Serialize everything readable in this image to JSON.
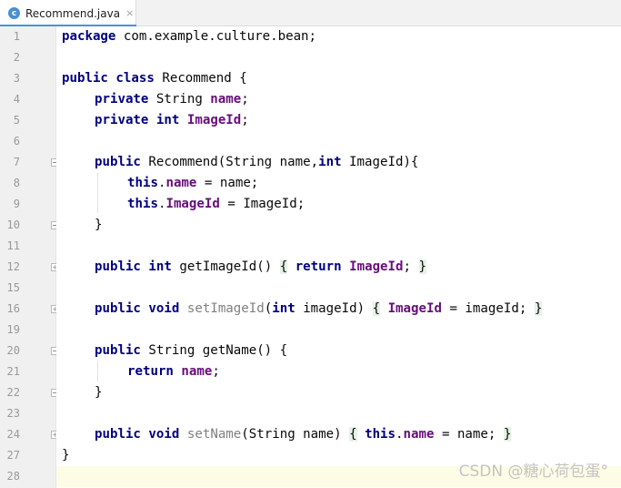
{
  "tab": {
    "title": "Recommend.java",
    "icon_letter": "c",
    "close_glyph": "×"
  },
  "line_numbers": [
    "1",
    "2",
    "3",
    "4",
    "5",
    "6",
    "7",
    "8",
    "9",
    "10",
    "11",
    "12",
    "15",
    "16",
    "19",
    "20",
    "21",
    "22",
    "23",
    "24",
    "27",
    "28"
  ],
  "code": {
    "l1_kw": "package",
    "l1_rest": " com.example.culture.bean;",
    "l3_kw1": "public",
    "l3_kw2": "class",
    "l3_rest": " Recommend {",
    "l4_kw": "private",
    "l4_type": " String ",
    "l4_field": "name",
    "l4_end": ";",
    "l5_kw1": "private",
    "l5_kw2": "int",
    "l5_field": "ImageId",
    "l5_end": ";",
    "l7_kw": "public",
    "l7_a": " Recommend(String name,",
    "l7_kw2": "int",
    "l7_b": " ImageId){",
    "l8_kw": "this",
    "l8_dot": ".",
    "l8_field": "name",
    "l8_rest": " = name;",
    "l9_kw": "this",
    "l9_dot": ".",
    "l9_field": "ImageId",
    "l9_rest": " = ImageId;",
    "l10": "}",
    "l12_kw1": "public",
    "l12_kw2": "int",
    "l12_a": " getImageId() ",
    "l12_ob": "{",
    "l12_kw3": "return",
    "l12_field": "ImageId",
    "l12_semi": ";",
    "l12_cb": "}",
    "l16_kw1": "public",
    "l16_kw2": "void",
    "l16_name": "setImageId",
    "l16_a": "(",
    "l16_kw3": "int",
    "l16_b": " imageId) ",
    "l16_ob": "{",
    "l16_field": "ImageId",
    "l16_c": " = imageId;",
    "l16_cb": "}",
    "l20_kw": "public",
    "l20_rest": " String getName() {",
    "l21_kw": "return",
    "l21_field": "name",
    "l21_end": ";",
    "l22": "}",
    "l24_kw1": "public",
    "l24_kw2": "void",
    "l24_name": "setName",
    "l24_a": "(String name) ",
    "l24_ob": "{",
    "l24_kw3": "this",
    "l24_dot": ".",
    "l24_field": "name",
    "l24_b": " = name;",
    "l24_cb": "}",
    "l27": "}"
  },
  "watermark": "CSDN @糖心荷包蛋°",
  "colors": {
    "keyword": "#000080",
    "field": "#660e7a",
    "unused": "#808080",
    "tab_accent": "#4a90e2",
    "current_line": "#fdfce5"
  }
}
